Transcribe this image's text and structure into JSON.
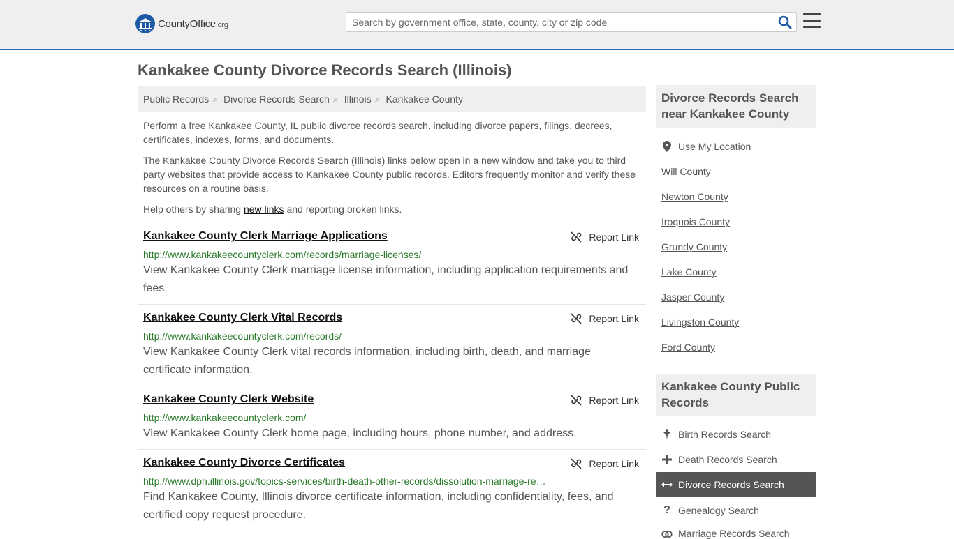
{
  "header": {
    "logo_county": "County",
    "logo_office": "Office",
    "logo_org": ".org",
    "search_placeholder": "Search by government office, state, county, city or zip code"
  },
  "page": {
    "title": "Kankakee County Divorce Records Search (Illinois)"
  },
  "breadcrumb": [
    "Public Records",
    "Divorce Records Search",
    "Illinois",
    "Kankakee County"
  ],
  "intro": {
    "p1": "Perform a free Kankakee County, IL public divorce records search, including divorce papers, filings, decrees, certificates, indexes, forms, and documents.",
    "p2": "The Kankakee County Divorce Records Search (Illinois) links below open in a new window and take you to third party websites that provide access to Kankakee County public records. Editors frequently monitor and verify these resources on a routine basis.",
    "p3_before": "Help others by sharing ",
    "p3_link": "new links",
    "p3_after": " and reporting broken links."
  },
  "report_label": "Report Link",
  "entries": [
    {
      "title": "Kankakee County Clerk Marriage Applications",
      "url": "http://www.kankakeecountyclerk.com/records/marriage-licenses/",
      "desc": "View Kankakee County Clerk marriage license information, including application requirements and fees."
    },
    {
      "title": "Kankakee County Clerk Vital Records",
      "url": "http://www.kankakeecountyclerk.com/records/",
      "desc": "View Kankakee County Clerk vital records information, including birth, death, and marriage certificate information."
    },
    {
      "title": "Kankakee County Clerk Website",
      "url": "http://www.kankakeecountyclerk.com/",
      "desc": "View Kankakee County Clerk home page, including hours, phone number, and address."
    },
    {
      "title": "Kankakee County Divorce Certificates",
      "url": "http://www.dph.illinois.gov/topics-services/birth-death-other-records/dissolution-marriage-re…",
      "desc": "Find Kankakee County, Illinois divorce certificate information, including confidentiality, fees, and certified copy request procedure."
    }
  ],
  "sidebar": {
    "nearby_heading": "Divorce Records Search near Kankakee County",
    "use_location": "Use My Location",
    "nearby": [
      "Will County",
      "Newton County",
      "Iroquois County",
      "Grundy County",
      "Lake County",
      "Jasper County",
      "Livingston County",
      "Ford County"
    ],
    "public_heading": "Kankakee County Public Records",
    "public_links": [
      {
        "label": "Birth Records Search",
        "icon": "person-icon"
      },
      {
        "label": "Death Records Search",
        "icon": "cross-icon"
      },
      {
        "label": "Divorce Records Search",
        "icon": "arrows-icon"
      },
      {
        "label": "Genealogy Search",
        "icon": "question-icon"
      },
      {
        "label": "Marriage Records Search",
        "icon": "rings-icon"
      }
    ]
  }
}
